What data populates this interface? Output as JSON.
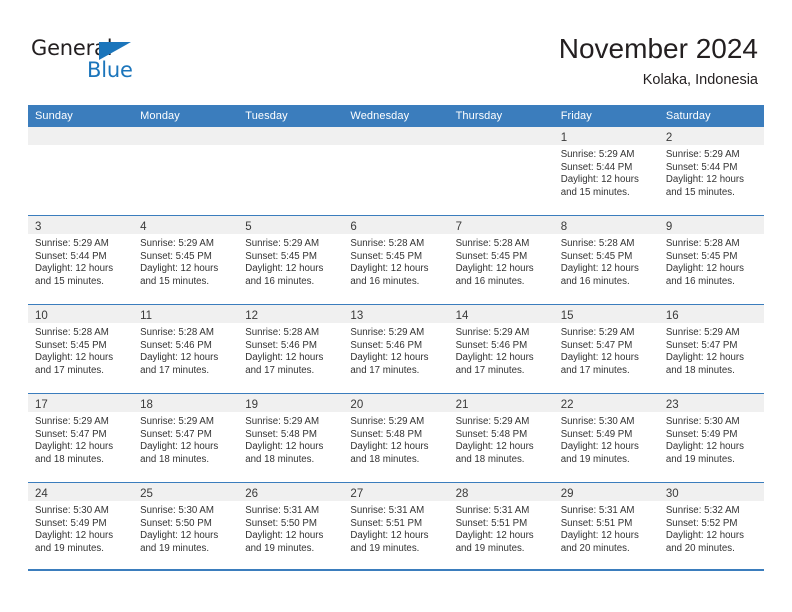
{
  "brand": {
    "word1": "General",
    "word2": "Blue",
    "triangle_color": "#1b75bb",
    "text_color": "#231f20"
  },
  "header": {
    "title": "November 2024",
    "subtitle": "Kolaka, Indonesia",
    "header_bg": "#3b7dbd",
    "daynum_bg": "#f0f0f0"
  },
  "calendar": {
    "weekday_headers": [
      "Sunday",
      "Monday",
      "Tuesday",
      "Wednesday",
      "Thursday",
      "Friday",
      "Saturday"
    ],
    "weeks": [
      [
        {
          "day": "",
          "lines": []
        },
        {
          "day": "",
          "lines": []
        },
        {
          "day": "",
          "lines": []
        },
        {
          "day": "",
          "lines": []
        },
        {
          "day": "",
          "lines": []
        },
        {
          "day": "1",
          "lines": [
            "Sunrise: 5:29 AM",
            "Sunset: 5:44 PM",
            "Daylight: 12 hours",
            "and 15 minutes."
          ]
        },
        {
          "day": "2",
          "lines": [
            "Sunrise: 5:29 AM",
            "Sunset: 5:44 PM",
            "Daylight: 12 hours",
            "and 15 minutes."
          ]
        }
      ],
      [
        {
          "day": "3",
          "lines": [
            "Sunrise: 5:29 AM",
            "Sunset: 5:44 PM",
            "Daylight: 12 hours",
            "and 15 minutes."
          ]
        },
        {
          "day": "4",
          "lines": [
            "Sunrise: 5:29 AM",
            "Sunset: 5:45 PM",
            "Daylight: 12 hours",
            "and 15 minutes."
          ]
        },
        {
          "day": "5",
          "lines": [
            "Sunrise: 5:29 AM",
            "Sunset: 5:45 PM",
            "Daylight: 12 hours",
            "and 16 minutes."
          ]
        },
        {
          "day": "6",
          "lines": [
            "Sunrise: 5:28 AM",
            "Sunset: 5:45 PM",
            "Daylight: 12 hours",
            "and 16 minutes."
          ]
        },
        {
          "day": "7",
          "lines": [
            "Sunrise: 5:28 AM",
            "Sunset: 5:45 PM",
            "Daylight: 12 hours",
            "and 16 minutes."
          ]
        },
        {
          "day": "8",
          "lines": [
            "Sunrise: 5:28 AM",
            "Sunset: 5:45 PM",
            "Daylight: 12 hours",
            "and 16 minutes."
          ]
        },
        {
          "day": "9",
          "lines": [
            "Sunrise: 5:28 AM",
            "Sunset: 5:45 PM",
            "Daylight: 12 hours",
            "and 16 minutes."
          ]
        }
      ],
      [
        {
          "day": "10",
          "lines": [
            "Sunrise: 5:28 AM",
            "Sunset: 5:45 PM",
            "Daylight: 12 hours",
            "and 17 minutes."
          ]
        },
        {
          "day": "11",
          "lines": [
            "Sunrise: 5:28 AM",
            "Sunset: 5:46 PM",
            "Daylight: 12 hours",
            "and 17 minutes."
          ]
        },
        {
          "day": "12",
          "lines": [
            "Sunrise: 5:28 AM",
            "Sunset: 5:46 PM",
            "Daylight: 12 hours",
            "and 17 minutes."
          ]
        },
        {
          "day": "13",
          "lines": [
            "Sunrise: 5:29 AM",
            "Sunset: 5:46 PM",
            "Daylight: 12 hours",
            "and 17 minutes."
          ]
        },
        {
          "day": "14",
          "lines": [
            "Sunrise: 5:29 AM",
            "Sunset: 5:46 PM",
            "Daylight: 12 hours",
            "and 17 minutes."
          ]
        },
        {
          "day": "15",
          "lines": [
            "Sunrise: 5:29 AM",
            "Sunset: 5:47 PM",
            "Daylight: 12 hours",
            "and 17 minutes."
          ]
        },
        {
          "day": "16",
          "lines": [
            "Sunrise: 5:29 AM",
            "Sunset: 5:47 PM",
            "Daylight: 12 hours",
            "and 18 minutes."
          ]
        }
      ],
      [
        {
          "day": "17",
          "lines": [
            "Sunrise: 5:29 AM",
            "Sunset: 5:47 PM",
            "Daylight: 12 hours",
            "and 18 minutes."
          ]
        },
        {
          "day": "18",
          "lines": [
            "Sunrise: 5:29 AM",
            "Sunset: 5:47 PM",
            "Daylight: 12 hours",
            "and 18 minutes."
          ]
        },
        {
          "day": "19",
          "lines": [
            "Sunrise: 5:29 AM",
            "Sunset: 5:48 PM",
            "Daylight: 12 hours",
            "and 18 minutes."
          ]
        },
        {
          "day": "20",
          "lines": [
            "Sunrise: 5:29 AM",
            "Sunset: 5:48 PM",
            "Daylight: 12 hours",
            "and 18 minutes."
          ]
        },
        {
          "day": "21",
          "lines": [
            "Sunrise: 5:29 AM",
            "Sunset: 5:48 PM",
            "Daylight: 12 hours",
            "and 18 minutes."
          ]
        },
        {
          "day": "22",
          "lines": [
            "Sunrise: 5:30 AM",
            "Sunset: 5:49 PM",
            "Daylight: 12 hours",
            "and 19 minutes."
          ]
        },
        {
          "day": "23",
          "lines": [
            "Sunrise: 5:30 AM",
            "Sunset: 5:49 PM",
            "Daylight: 12 hours",
            "and 19 minutes."
          ]
        }
      ],
      [
        {
          "day": "24",
          "lines": [
            "Sunrise: 5:30 AM",
            "Sunset: 5:49 PM",
            "Daylight: 12 hours",
            "and 19 minutes."
          ]
        },
        {
          "day": "25",
          "lines": [
            "Sunrise: 5:30 AM",
            "Sunset: 5:50 PM",
            "Daylight: 12 hours",
            "and 19 minutes."
          ]
        },
        {
          "day": "26",
          "lines": [
            "Sunrise: 5:31 AM",
            "Sunset: 5:50 PM",
            "Daylight: 12 hours",
            "and 19 minutes."
          ]
        },
        {
          "day": "27",
          "lines": [
            "Sunrise: 5:31 AM",
            "Sunset: 5:51 PM",
            "Daylight: 12 hours",
            "and 19 minutes."
          ]
        },
        {
          "day": "28",
          "lines": [
            "Sunrise: 5:31 AM",
            "Sunset: 5:51 PM",
            "Daylight: 12 hours",
            "and 19 minutes."
          ]
        },
        {
          "day": "29",
          "lines": [
            "Sunrise: 5:31 AM",
            "Sunset: 5:51 PM",
            "Daylight: 12 hours",
            "and 20 minutes."
          ]
        },
        {
          "day": "30",
          "lines": [
            "Sunrise: 5:32 AM",
            "Sunset: 5:52 PM",
            "Daylight: 12 hours",
            "and 20 minutes."
          ]
        }
      ]
    ]
  }
}
